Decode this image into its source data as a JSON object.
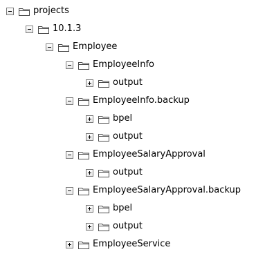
{
  "tree": {
    "rows": [
      {
        "label": "projects",
        "expanded": true,
        "icon": "folder-icon"
      },
      {
        "label": "10.1.3",
        "expanded": true,
        "icon": "folder-icon"
      },
      {
        "label": "Employee",
        "expanded": true,
        "icon": "folder-icon"
      },
      {
        "label": "EmployeeInfo",
        "expanded": true,
        "icon": "folder-icon"
      },
      {
        "label": "output",
        "expanded": false,
        "icon": "folder-icon"
      },
      {
        "label": "EmployeeInfo.backup",
        "expanded": true,
        "icon": "folder-icon"
      },
      {
        "label": "bpel",
        "expanded": false,
        "icon": "folder-icon"
      },
      {
        "label": "output",
        "expanded": false,
        "icon": "folder-icon"
      },
      {
        "label": "EmployeeSalaryApproval",
        "expanded": true,
        "icon": "folder-icon"
      },
      {
        "label": "output",
        "expanded": false,
        "icon": "folder-icon"
      },
      {
        "label": "EmployeeSalaryApproval.backup",
        "expanded": true,
        "icon": "folder-icon"
      },
      {
        "label": "bpel",
        "expanded": false,
        "icon": "folder-icon"
      },
      {
        "label": "output",
        "expanded": false,
        "icon": "folder-icon"
      },
      {
        "label": "EmployeeService",
        "expanded": false,
        "icon": "folder-icon"
      }
    ]
  }
}
